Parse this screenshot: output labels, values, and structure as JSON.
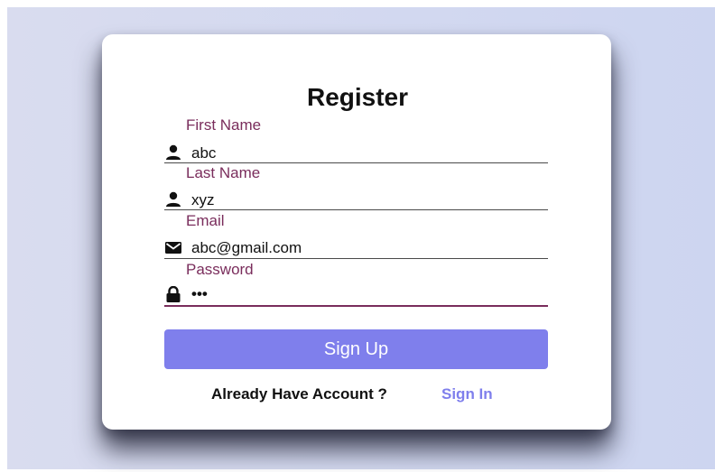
{
  "form": {
    "title": "Register",
    "fields": [
      {
        "label": "First Name",
        "value": "abc",
        "icon": "user-icon"
      },
      {
        "label": "Last Name",
        "value": "xyz",
        "icon": "user-icon"
      },
      {
        "label": "Email",
        "value": "abc@gmail.com",
        "icon": "envelope-icon"
      },
      {
        "label": "Password",
        "value": "•••",
        "icon": "lock-icon"
      }
    ],
    "submit_label": "Sign Up",
    "footer_text": "Already Have Account ?",
    "signin_label": "Sign In"
  },
  "colors": {
    "label": "#7a2d5c",
    "button": "#7f7fec",
    "link": "#7f7fec",
    "background": "#d3d9f0"
  }
}
